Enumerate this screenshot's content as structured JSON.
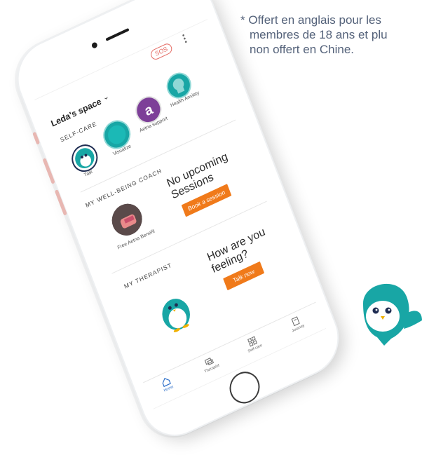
{
  "footnote": {
    "line1": "* Offert en anglais pour les",
    "line2": "membres de 18 ans et plu",
    "line3": "non offert en Chine."
  },
  "header": {
    "sos_label": "SOS",
    "space_title": "Leda's space",
    "chevron": "⌄"
  },
  "self_care": {
    "section_label": "SELF-CARE",
    "items": [
      {
        "label": "Talk",
        "icon": "wysa-penguin-icon"
      },
      {
        "label": "Visualize",
        "icon": "teal-circle-icon"
      },
      {
        "label": "Aetna support",
        "icon": "aetna-logo-icon"
      },
      {
        "label": "Health Anxiety",
        "icon": "head-silhouette-icon"
      }
    ]
  },
  "coach": {
    "section_label": "MY WELL-BEING COACH",
    "status_title": "No upcoming Sessions",
    "button_label": "Book a session",
    "benefit_label": "Free Aetna Benefit"
  },
  "therapist": {
    "section_label": "MY THERAPIST",
    "prompt_title": "How are you feeling?",
    "button_label": "Talk now"
  },
  "tabbar": {
    "tabs": [
      {
        "label": "Home",
        "icon": "home-icon",
        "active": true
      },
      {
        "label": "Therapist",
        "icon": "chat-icon",
        "active": false
      },
      {
        "label": "Self-care",
        "icon": "grid-icon",
        "active": false
      },
      {
        "label": "Journey",
        "icon": "journal-icon",
        "active": false
      }
    ]
  },
  "colors": {
    "accent_orange": "#f07a1a",
    "teal": "#18a6a5",
    "aetna_purple": "#7d3f98",
    "sos_red": "#e46a63",
    "active_tab_blue": "#2d6fc9"
  }
}
